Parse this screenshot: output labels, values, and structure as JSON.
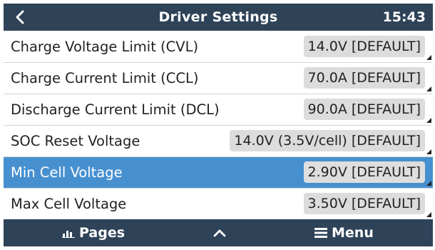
{
  "header": {
    "title": "Driver Settings",
    "time": "15:43",
    "back_icon": "chevron-left-icon"
  },
  "rows": [
    {
      "label": "Charge Voltage Limit (CVL)",
      "value": "14.0V [DEFAULT]",
      "selected": false
    },
    {
      "label": "Charge Current Limit (CCL)",
      "value": "70.0A [DEFAULT]",
      "selected": false
    },
    {
      "label": "Discharge Current Limit (DCL)",
      "value": "90.0A [DEFAULT]",
      "selected": false
    },
    {
      "label": "SOC Reset Voltage",
      "value": "14.0V (3.5V/cell) [DEFAULT]",
      "selected": false
    },
    {
      "label": "Min Cell Voltage",
      "value": "2.90V [DEFAULT]",
      "selected": true
    },
    {
      "label": "Max Cell Voltage",
      "value": "3.50V [DEFAULT]",
      "selected": false
    }
  ],
  "footer": {
    "pages_label": "Pages",
    "pages_icon": "bar-chart-icon",
    "up_icon": "chevron-up-icon",
    "menu_label": "Menu",
    "menu_icon": "hamburger-icon"
  },
  "colors": {
    "bar": "#2e4358",
    "selected": "#4790d0",
    "value_box": "#dcdcdc"
  }
}
